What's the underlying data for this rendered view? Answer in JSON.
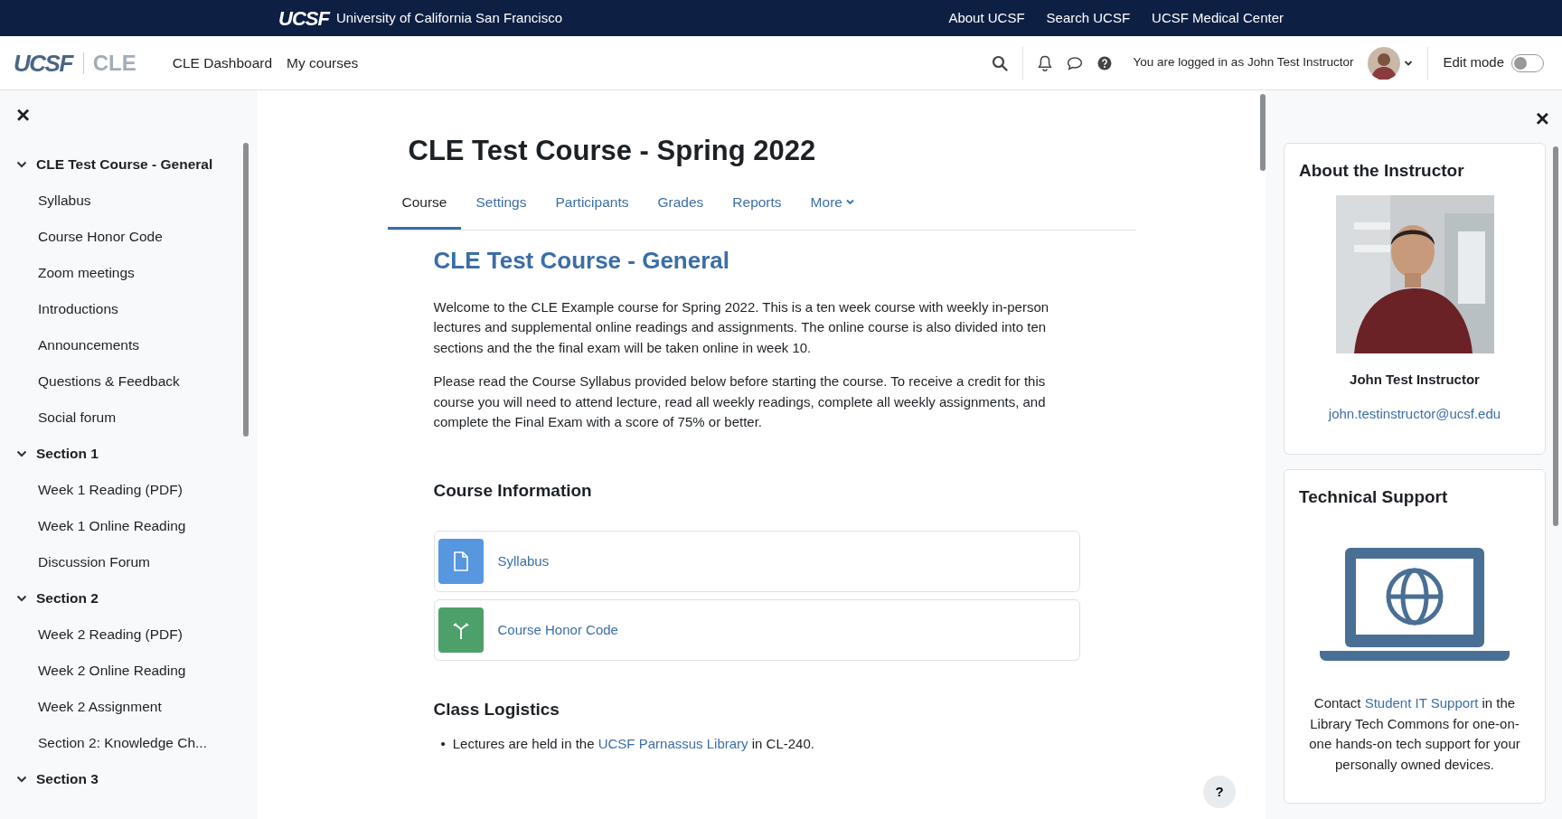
{
  "top_bar": {
    "logo": "UCSF",
    "brand_name": "University of California San Francisco",
    "links": [
      "About UCSF",
      "Search UCSF",
      "UCSF Medical Center"
    ]
  },
  "navbar": {
    "logo": "UCSF",
    "product": "CLE",
    "links": [
      "CLE Dashboard",
      "My courses"
    ],
    "user_text": "You are logged in as John Test Instructor",
    "edit_mode": {
      "label": "Edit mode",
      "on": false
    }
  },
  "course_index": {
    "close": "×",
    "sections": [
      {
        "title": "CLE Test Course - General",
        "expanded": true,
        "items": [
          "Syllabus",
          "Course Honor Code",
          "Zoom meetings",
          "Introductions",
          "Announcements",
          "Questions & Feedback",
          "Social forum"
        ]
      },
      {
        "title": "Section 1",
        "expanded": true,
        "items": [
          "Week 1 Reading (PDF)",
          "Week 1 Online Reading",
          "Discussion Forum"
        ]
      },
      {
        "title": "Section 2",
        "expanded": true,
        "items": [
          "Week 2 Reading (PDF)",
          "Week 2 Online Reading",
          "Week 2 Assignment",
          "Section 2: Knowledge Ch..."
        ]
      },
      {
        "title": "Section 3",
        "expanded": true
      }
    ]
  },
  "course": {
    "title": "CLE Test Course - Spring 2022",
    "tabs": [
      {
        "label": "Course",
        "selected": true,
        "kind": "link"
      },
      {
        "label": "Settings",
        "selected": false,
        "kind": "link"
      },
      {
        "label": "Participants",
        "selected": false,
        "kind": "link"
      },
      {
        "label": "Grades",
        "selected": false,
        "kind": "link"
      },
      {
        "label": "Reports",
        "selected": false,
        "kind": "link"
      },
      {
        "label": "More",
        "selected": false,
        "kind": "dropdown"
      }
    ],
    "section_title": "CLE Test Course - General",
    "paragraphs": [
      "Welcome to the CLE Example course for Spring 2022. This is a ten week course with weekly in-person lectures and supplemental online readings and assignments. The online course is also divided into ten sections and the the final exam will be taken online in week 10.",
      "Please read the Course Syllabus provided below before starting the course. To receive a credit for this course you will need to attend lecture, read all weekly readings, complete all weekly assignments, and complete the Final Exam with a score of 75% or better."
    ],
    "course_information": {
      "heading": "Course Information",
      "activities": [
        {
          "kind": "file",
          "name": "Syllabus"
        },
        {
          "kind": "page",
          "name": "Course Honor Code"
        }
      ]
    },
    "class_logistics": {
      "heading": "Class Logistics",
      "bullets": [
        {
          "marker": "•",
          "before": "Lectures are held in the ",
          "link": "UCSF Parnassus Library",
          "after": " in CL-240."
        }
      ]
    }
  },
  "help_button": "?",
  "blocks": {
    "close": "×",
    "about_instructor": {
      "title": "About the Instructor",
      "name": "John Test Instructor",
      "email": "john.testinstructor@ucsf.edu"
    },
    "technical_support": {
      "title": "Technical Support",
      "before": "Contact ",
      "link": "Student IT Support",
      "after": " in the Library Tech Commons for one-on-one hands-on tech support for your personally owned devices."
    }
  }
}
